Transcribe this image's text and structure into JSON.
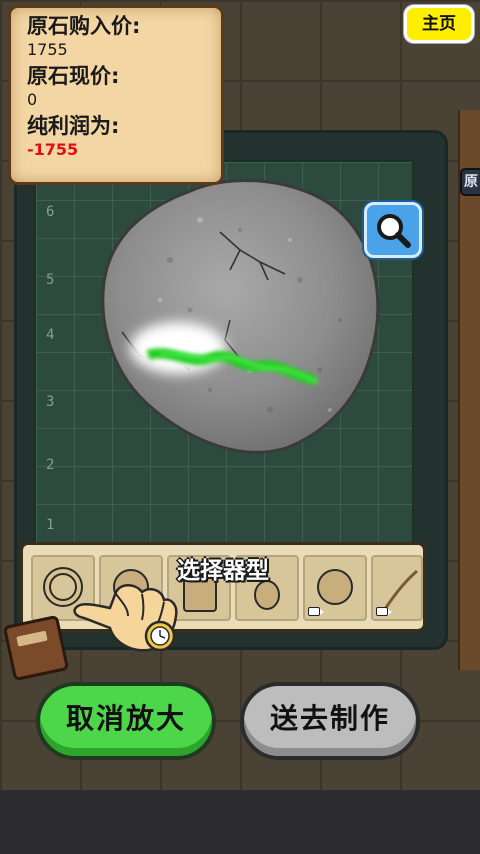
{
  "stats": {
    "purchase_label": "原石购入价:",
    "purchase_value": "1755",
    "current_label": "原石现价:",
    "current_value": "0",
    "profit_label": "纯利润为:",
    "profit_value": "-1755"
  },
  "home_button": "主页",
  "side_tab": "原",
  "mat_numbers": [
    "6",
    "5",
    "4",
    "3",
    "2",
    "1"
  ],
  "tray": {
    "title": "选择器型",
    "slots": [
      {
        "icon": "ring-icon",
        "video": false
      },
      {
        "icon": "disc-icon",
        "video": false
      },
      {
        "icon": "rectangle-pendant-icon",
        "video": false
      },
      {
        "icon": "drop-pendant-icon",
        "video": false
      },
      {
        "icon": "round-pendant-icon",
        "video": true
      },
      {
        "icon": "bangle-icon",
        "video": true
      }
    ]
  },
  "buttons": {
    "cancel_zoom": "取消放大",
    "send_to_craft": "送去制作"
  },
  "colors": {
    "home_button": "#ffee00",
    "profit_negative": "#e01010",
    "cancel_button": "#4dd64a",
    "craft_button": "#bdbdbd",
    "jade_vein": "#22cc22",
    "magnify_button": "#4aa3e8"
  }
}
